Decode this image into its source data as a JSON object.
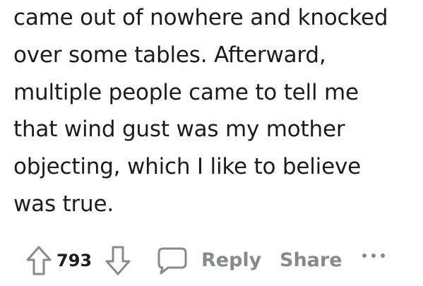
{
  "comment": {
    "lines": [
      "came out of nowhere and knocked",
      "over some tables. Afterward,",
      "multiple people came to tell me",
      "that wind gust was my mother",
      "objecting, which I like to believe",
      "was true."
    ]
  },
  "actions": {
    "upvote_icon": "arrow-up-outline-icon",
    "vote_count": "793",
    "downvote_icon": "arrow-down-outline-icon",
    "reply_icon": "speech-bubble-icon",
    "reply_label": "Reply",
    "share_label": "Share",
    "more_icon": "ellipsis-icon"
  },
  "colors": {
    "text": "#1c1c1c",
    "muted": "#878a8c"
  }
}
